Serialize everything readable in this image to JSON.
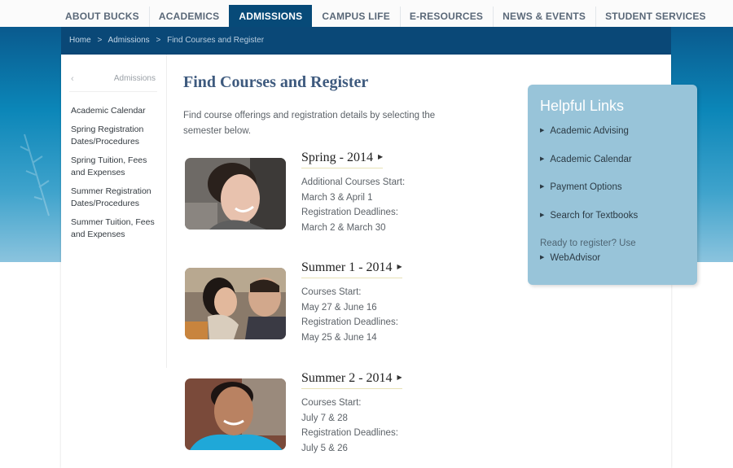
{
  "topnav": {
    "items": [
      {
        "label": "ABOUT BUCKS",
        "active": false
      },
      {
        "label": "ACADEMICS",
        "active": false
      },
      {
        "label": "ADMISSIONS",
        "active": true
      },
      {
        "label": "CAMPUS LIFE",
        "active": false
      },
      {
        "label": "E-RESOURCES",
        "active": false
      },
      {
        "label": "NEWS & EVENTS",
        "active": false
      },
      {
        "label": "STUDENT SERVICES",
        "active": false
      }
    ]
  },
  "breadcrumb": {
    "items": [
      "Home",
      "Admissions",
      "Find Courses and Register"
    ],
    "separator": ">"
  },
  "sidebar": {
    "back_icon": "‹",
    "section_title": "Admissions",
    "items": [
      {
        "label": "Academic Calendar"
      },
      {
        "label": "Spring Registration Dates/Procedures"
      },
      {
        "label": "Spring Tuition, Fees and Expenses"
      },
      {
        "label": "Summer Registration Dates/Procedures"
      },
      {
        "label": "Summer Tuition, Fees and Expenses"
      }
    ]
  },
  "main": {
    "title": "Find Courses and Register",
    "intro": "Find course offerings and registration details by selecting the semester below.",
    "terms": [
      {
        "title": "Spring - 2014",
        "lines": [
          "Additional Courses Start:",
          "March 3 & April 1",
          "Registration Deadlines:",
          "March 2 & March 30"
        ],
        "photo": "smiling-student-woman"
      },
      {
        "title": "Summer 1 - 2014",
        "lines": [
          "Courses Start:",
          "May 27 & June 16",
          "Registration Deadlines:",
          "May 25 & June 14"
        ],
        "photo": "two-students-laughing"
      },
      {
        "title": "Summer 2 - 2014",
        "lines": [
          "Courses Start:",
          "July 7 & 28",
          "Registration Deadlines:",
          "July 5 & 26"
        ],
        "photo": "smiling-student-man"
      }
    ],
    "arrow_icon": "▶"
  },
  "helpful_links": {
    "title": "Helpful Links",
    "items": [
      {
        "label": "Academic Advising"
      },
      {
        "label": "Academic Calendar"
      },
      {
        "label": "Payment Options"
      },
      {
        "label": "Search for Textbooks"
      }
    ],
    "ready_text": "Ready to register? Use",
    "webadvisor_label": "WebAdvisor",
    "bullet_icon": "▶"
  },
  "colors": {
    "nav_active": "#074a78",
    "breadcrumb_bar": "#0a4877",
    "helpful_box": "#98c4d9",
    "title_blue": "#3e5a7e"
  }
}
